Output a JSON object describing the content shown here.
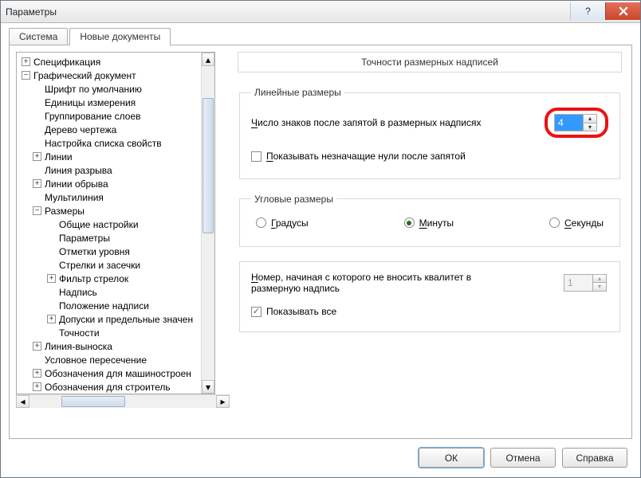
{
  "window": {
    "title": "Параметры"
  },
  "tabs": {
    "system": "Система",
    "new_docs": "Новые документы"
  },
  "tree": {
    "spec": "Спецификация",
    "graph_doc": "Графический документ",
    "font_default": "Шрифт по умолчанию",
    "units": "Единицы измерения",
    "layer_group": "Группирование слоев",
    "drawing_tree": "Дерево чертежа",
    "props_list": "Настройка списка свойств",
    "lines": "Линии",
    "break_line": "Линия разрыва",
    "cutoff_lines": "Линии обрыва",
    "multiline": "Мультилиния",
    "dimensions": "Размеры",
    "general": "Общие настройки",
    "parameters": "Параметры",
    "level_marks": "Отметки уровня",
    "arrows_notches": "Стрелки и засечки",
    "arrow_filter": "Фильтр стрелок",
    "label": "Надпись",
    "label_pos": "Положение надписи",
    "tolerances": "Допуски и предельные значен",
    "precisions": "Точности",
    "leader": "Линия-выноска",
    "cond_intersect": "Условное пересечение",
    "mech_notes": "Обозначения для машиностроен",
    "trailing": "Обозначения для строитель"
  },
  "panel": {
    "title": "Точности размерных надписей",
    "linear_group": "Линейные размеры",
    "decimals_label_pre": "Ч",
    "decimals_label_rest": "исло знаков после запятой в размерных надписях",
    "decimals_value": "4",
    "show_zeros_pre": "П",
    "show_zeros_rest": "оказывать незначащие нули после запятой",
    "angular_group": "Угловые размеры",
    "degrees_pre": "Г",
    "degrees_rest": "радусы",
    "minutes_pre": "М",
    "minutes_rest": "инуты",
    "seconds_pre": "С",
    "seconds_rest": "екунды",
    "quality_pre": "Н",
    "quality_rest": "омер, начиная с которого не вносить квалитет в размерную надпись",
    "quality_value": "1",
    "show_all_label": "Показывать все"
  },
  "buttons": {
    "ok": "ОК",
    "cancel": "Отмена",
    "help": "Справка"
  }
}
